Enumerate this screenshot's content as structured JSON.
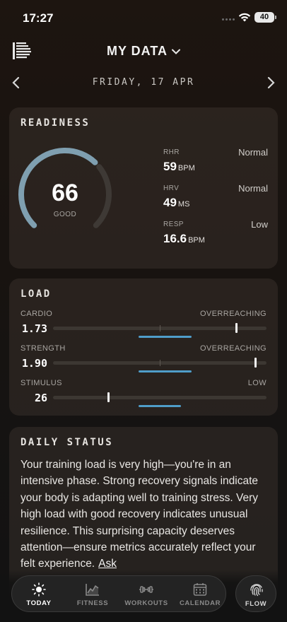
{
  "status_bar": {
    "time": "17:27",
    "battery": "40"
  },
  "header": {
    "title": "MY DATA"
  },
  "date_nav": {
    "label": "FRIDAY, 17 APR"
  },
  "readiness": {
    "title": "READINESS",
    "score": "66",
    "score_fraction": 0.66,
    "score_label": "GOOD",
    "gauge_color": "#7f9fb0",
    "metrics": [
      {
        "label": "RHR",
        "value": "59",
        "unit": "BPM",
        "status": "Normal"
      },
      {
        "label": "HRV",
        "value": "49",
        "unit": "MS",
        "status": "Normal"
      },
      {
        "label": "RESP",
        "value": "16.6",
        "unit": "BPM",
        "status": "Low"
      }
    ]
  },
  "load": {
    "title": "LOAD",
    "accent": "#4f9dc9",
    "rows": [
      {
        "label": "CARDIO",
        "value": "1.73",
        "status": "OVERREACHING",
        "marker": 0.86,
        "range_start": 0.4,
        "range_end": 0.65
      },
      {
        "label": "STRENGTH",
        "value": "1.90",
        "status": "OVERREACHING",
        "marker": 0.95,
        "range_start": 0.4,
        "range_end": 0.65
      },
      {
        "label": "STIMULUS",
        "value": "26",
        "status": "LOW",
        "marker": 0.26,
        "range_start": 0.4,
        "range_end": 0.6
      }
    ]
  },
  "daily_status": {
    "title": "DAILY STATUS",
    "text": "Your training load is very high—you're in an intensive phase. Strong recovery signals indicate your body is adapting well to training stress. Very high load with good recovery indicates unusual resilience. This surprising capacity deserves attention—ensure metrics accurately reflect your felt experience.",
    "ask_label": "Ask"
  },
  "nav": {
    "tabs": [
      {
        "label": "TODAY",
        "icon": "sun-icon",
        "active": true
      },
      {
        "label": "FITNESS",
        "icon": "chart-icon",
        "active": false
      },
      {
        "label": "WORKOUTS",
        "icon": "dumbbell-icon",
        "active": false
      },
      {
        "label": "CALENDAR",
        "icon": "calendar-icon",
        "active": false
      }
    ],
    "flow_label": "FLOW"
  }
}
